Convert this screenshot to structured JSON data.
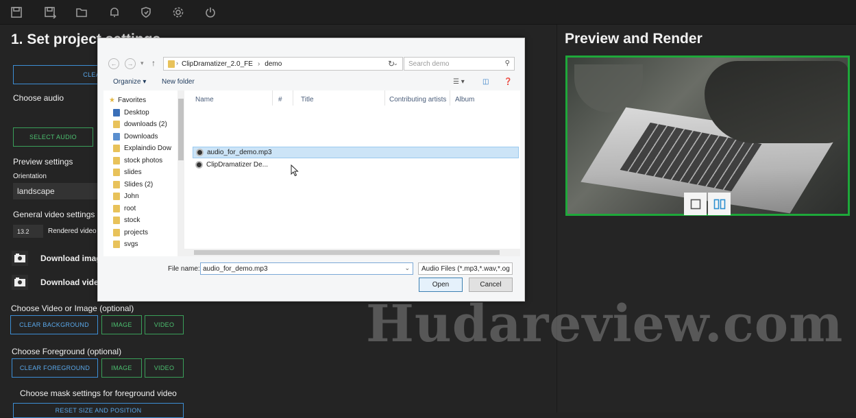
{
  "toolbar": {
    "icons": [
      "save-icon",
      "save-as-icon",
      "folder-icon",
      "bell-icon",
      "shield-icon",
      "gear-icon",
      "power-icon"
    ]
  },
  "left": {
    "title": "1. Set project settings",
    "clear_all_label": "CLEAR AL",
    "choose_audio_label": "Choose audio",
    "select_audio_label": "SELECT AUDIO",
    "preview_settings_label": "Preview settings",
    "orientation_label": "Orientation",
    "orientation_value": "landscape",
    "general_video_label": "General video settings",
    "duration_value": "13.2",
    "rendered_label": "Rendered video d",
    "download_image_label": "Download imag",
    "download_video_label": "Download vide",
    "choose_video_image_label": "Choose Video or Image (optional)",
    "clear_background_label": "CLEAR BACKGROUND",
    "image_label": "IMAGE",
    "video_label": "VIDEO",
    "choose_foreground_label": "Choose Foreground (optional)",
    "clear_foreground_label": "CLEAR FOREGROUND",
    "mask_settings_label": "Choose mask settings for foreground video",
    "reset_label": "RESET SIZE AND POSITION"
  },
  "right": {
    "title": "Preview and Render"
  },
  "dialog": {
    "path": [
      "ClipDramatizer_2.0_FE",
      "demo"
    ],
    "search_placeholder": "Search demo",
    "organize_label": "Organize ▾",
    "new_folder_label": "New folder",
    "nav_items": [
      {
        "label": "Favorites",
        "icon": "star-icon"
      },
      {
        "label": "Desktop",
        "icon": "desktop-icon"
      },
      {
        "label": "downloads (2)",
        "icon": "folder-icon"
      },
      {
        "label": "Downloads",
        "icon": "download-folder-icon"
      },
      {
        "label": "Explaindio Dow",
        "icon": "folder-icon"
      },
      {
        "label": "stock photos",
        "icon": "folder-icon"
      },
      {
        "label": "slides",
        "icon": "folder-icon"
      },
      {
        "label": "Slides (2)",
        "icon": "folder-icon"
      },
      {
        "label": "John",
        "icon": "folder-icon"
      },
      {
        "label": "root",
        "icon": "folder-icon"
      },
      {
        "label": "stock",
        "icon": "folder-icon"
      },
      {
        "label": "projects",
        "icon": "folder-icon"
      },
      {
        "label": "svgs",
        "icon": "folder-icon"
      }
    ],
    "columns": [
      "Name",
      "#",
      "Title",
      "Contributing artists",
      "Album"
    ],
    "files": [
      {
        "name": "audio_for_demo.mp3",
        "selected": true
      },
      {
        "name": "ClipDramatizer De...",
        "selected": false
      }
    ],
    "file_name_label": "File name:",
    "file_name_value": "audio_for_demo.mp3",
    "file_type_value": "Audio Files (*.mp3,*.wav,*.og",
    "open_label": "Open",
    "cancel_label": "Cancel"
  },
  "watermark": "Hudareview.com",
  "colors": {
    "accent_blue": "#3d8fd6",
    "accent_green": "#3aa05a",
    "preview_border": "#1ea83a"
  }
}
